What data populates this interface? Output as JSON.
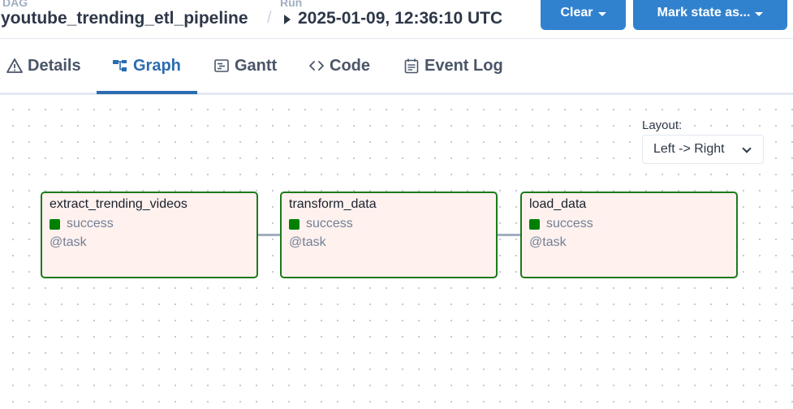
{
  "header": {
    "dag_label": "DAG",
    "dag_name": "youtube_trending_etl_pipeline",
    "separator": "/",
    "run_label": "Run",
    "run_value": "2025-01-09, 12:36:10 UTC",
    "clear_button": "Clear",
    "mark_state_button": "Mark state as..."
  },
  "tabs": [
    {
      "label": "Details",
      "icon": "warning-triangle-icon"
    },
    {
      "label": "Graph",
      "icon": "graph-icon",
      "active": true
    },
    {
      "label": "Gantt",
      "icon": "gantt-icon"
    },
    {
      "label": "Code",
      "icon": "code-icon"
    },
    {
      "label": "Event Log",
      "icon": "event-log-icon"
    }
  ],
  "layout": {
    "label": "Layout:",
    "value": "Left -> Right"
  },
  "nodes": [
    {
      "task_id": "extract_trending_videos",
      "state": "success",
      "operator": "@task"
    },
    {
      "task_id": "transform_data",
      "state": "success",
      "operator": "@task"
    },
    {
      "task_id": "load_data",
      "state": "success",
      "operator": "@task"
    }
  ],
  "colors": {
    "accent": "#3182ce",
    "active_tab": "#2b6cb0",
    "success": "#008000",
    "node_border": "#1b7a1b",
    "node_fill": "#fff1ee"
  }
}
